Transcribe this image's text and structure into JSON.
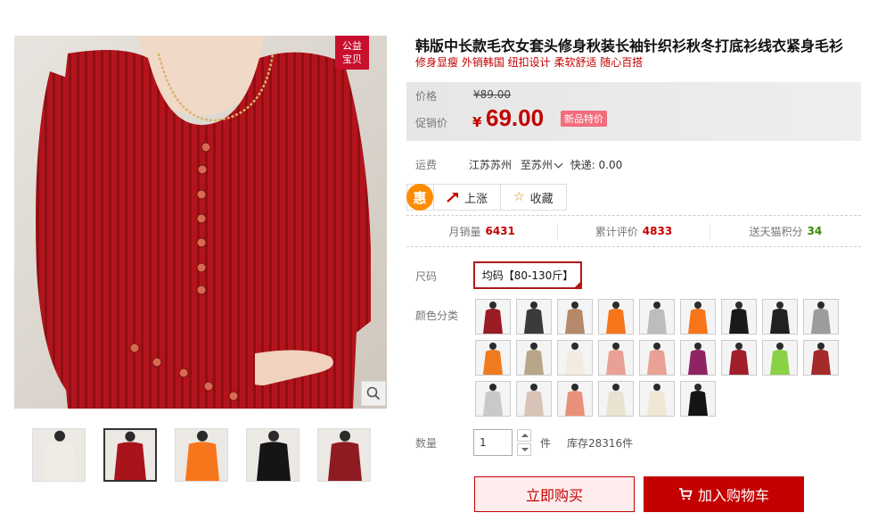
{
  "gallery": {
    "badge": "公益\n宝贝",
    "badge_line1": "公益",
    "badge_line2": "宝贝",
    "thumbnail_colors": [
      "#f1ece3",
      "#a8141a",
      "#f7751b",
      "#151515",
      "#8f1b22"
    ]
  },
  "product": {
    "title": "韩版中长款毛衣女套头修身秋装长袖针织衫秋冬打底衫线衣紧身毛衫",
    "subtitle": "修身显瘦 外销韩国 纽扣设计 柔软舒适 随心百搭"
  },
  "price": {
    "original_label": "价格",
    "original_value": "¥89.00",
    "promo_label": "促销价",
    "currency": "¥",
    "promo_value": "69.00",
    "promo_badge": "新品特价"
  },
  "shipping": {
    "label": "运费",
    "from": "江苏苏州",
    "to": "至苏州",
    "express": "快递: 0.00"
  },
  "actions": {
    "hui_icon_text": "惠",
    "trend_label": "上涨",
    "favorite_label": "收藏"
  },
  "stats": {
    "monthly_sales_label": "月销量",
    "monthly_sales_value": "6431",
    "reviews_label": "累计评价",
    "reviews_value": "4833",
    "points_label": "送天猫积分",
    "points_value": "34"
  },
  "sku": {
    "size_label": "尺码",
    "size_selected": "均码【80-130斤】",
    "color_label": "颜色分类",
    "color_swatches": [
      "#9a1c24",
      "#3b3b3b",
      "#b48a6a",
      "#f7751b",
      "#bdbdbd",
      "#f7751b",
      "#1a1a1a",
      "#222222",
      "#9c9c9c",
      "#f07a1e",
      "#b8a688",
      "#f2ece0",
      "#e9a195",
      "#e9a195",
      "#8f2464",
      "#a11e2a",
      "#8ad145",
      "#a52a2a",
      "#c9c9c9",
      "#d9c3b6",
      "#e99078",
      "#e8e2d0",
      "#efe6d3",
      "#141414"
    ],
    "quantity_label": "数量",
    "quantity_value": "1",
    "quantity_unit": "件",
    "stock": "库存28316件"
  },
  "buttons": {
    "buy_now": "立即购买",
    "add_to_cart": "加入购物车"
  },
  "colors": {
    "brand_red": "#c40000",
    "accent_orange": "#ff8c00"
  }
}
